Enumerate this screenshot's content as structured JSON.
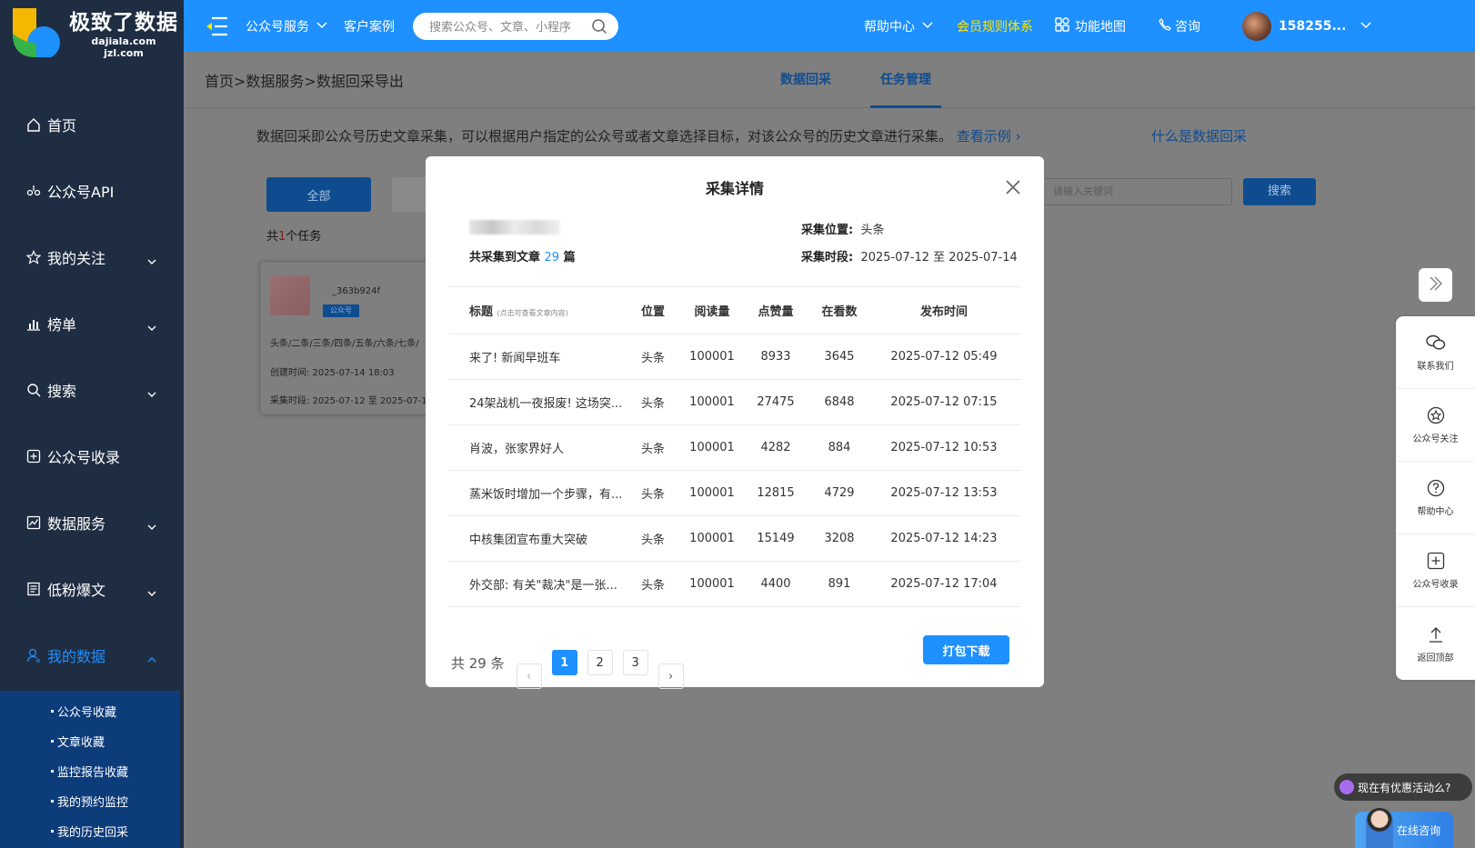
{
  "brand": {
    "name": "极致了数据",
    "domain1": "dajiala.com",
    "domain2": "jzl.com"
  },
  "sidebar": {
    "items": [
      {
        "label": "首页",
        "icon": "home-icon"
      },
      {
        "label": "公众号API",
        "icon": "api-icon"
      },
      {
        "label": "我的关注",
        "icon": "star-icon"
      },
      {
        "label": "榜单",
        "icon": "bar-chart-icon"
      },
      {
        "label": "搜索",
        "icon": "search-icon"
      },
      {
        "label": "公众号收录",
        "icon": "plus-square-icon"
      },
      {
        "label": "数据服务",
        "icon": "line-chart-icon"
      },
      {
        "label": "低粉爆文",
        "icon": "document-icon"
      },
      {
        "label": "我的数据",
        "icon": "user-icon"
      }
    ],
    "subitems": [
      "公众号收藏",
      "文章收藏",
      "监控报告收藏",
      "我的预约监控",
      "我的历史回采"
    ]
  },
  "topbar": {
    "service": "公众号服务",
    "cases": "客户案例",
    "search_placeholder": "搜索公众号、文章、小程序",
    "help": "帮助中心",
    "member": "会员规则体系",
    "function_map": "功能地图",
    "consult": "咨询",
    "user": "158255..."
  },
  "page": {
    "breadcrumb": "首页>数据服务>数据回采导出",
    "tabs": [
      "数据回采",
      "任务管理"
    ],
    "intro": "数据回采即公众号历史文章采集，可以根据用户指定的公众号或者文章选择目标，对该公众号的历史文章进行采集。",
    "intro_link": "查看示例",
    "whatis": "什么是数据回采",
    "btn_all": "全部",
    "count_prefix": "共",
    "count_num": "1",
    "count_suffix": "个任务",
    "keyword_placeholder": "请输入关键词",
    "search_btn": "搜索"
  },
  "task_card": {
    "id": "_363b924f",
    "tag": "公众号",
    "positions": "头条/二条/三条/四条/五条/六条/七条/",
    "created": "创建时间:  2025-07-14 18:03",
    "period": "采集时段:  2025-07-12 至 2025-07-1"
  },
  "modal": {
    "title": "采集详情",
    "total_prefix": "共采集到文章 ",
    "total_num": "29",
    "total_suffix": " 篇",
    "position_label": "采集位置:",
    "position_value": "头条",
    "period_label": "采集时段:",
    "period_value": "2025-07-12 至 2025-07-14",
    "columns": {
      "title": "标题",
      "title_hint": "(点击可查看文章内容)",
      "position": "位置",
      "reads": "阅读量",
      "likes": "点赞量",
      "watching": "在看数",
      "published": "发布时间"
    },
    "rows": [
      {
        "title": "来了! 新闻早班车",
        "position": "头条",
        "reads": "100001",
        "likes": "8933",
        "watching": "3645",
        "published": "2025-07-12 05:49"
      },
      {
        "title": "24架战机一夜报废! 这场突...",
        "position": "头条",
        "reads": "100001",
        "likes": "27475",
        "watching": "6848",
        "published": "2025-07-12 07:15"
      },
      {
        "title": "肖波，张家界好人",
        "position": "头条",
        "reads": "100001",
        "likes": "4282",
        "watching": "884",
        "published": "2025-07-12 10:53"
      },
      {
        "title": "蒸米饭时增加一个步骤，有...",
        "position": "头条",
        "reads": "100001",
        "likes": "12815",
        "watching": "4729",
        "published": "2025-07-12 13:53"
      },
      {
        "title": "中核集团宣布重大突破",
        "position": "头条",
        "reads": "100001",
        "likes": "15149",
        "watching": "3208",
        "published": "2025-07-12 14:23"
      },
      {
        "title": "外交部: 有关\"裁决\"是一张...",
        "position": "头条",
        "reads": "100001",
        "likes": "4400",
        "watching": "891",
        "published": "2025-07-12 17:04"
      }
    ],
    "pager": {
      "total": "共 29 条",
      "pages": [
        "1",
        "2",
        "3"
      ],
      "prev": "‹",
      "next": "›"
    },
    "download": "打包下载"
  },
  "float_panel": {
    "items": [
      {
        "label": "联系我们",
        "icon": "wechat-icon"
      },
      {
        "label": "公众号关注",
        "icon": "star-circle-icon"
      },
      {
        "label": "帮助中心",
        "icon": "question-icon"
      },
      {
        "label": "公众号收录",
        "icon": "plus-box-icon"
      },
      {
        "label": "返回顶部",
        "icon": "upload-icon"
      }
    ]
  },
  "promo": "现在有优惠活动么?",
  "online_consult": "在线咨询",
  "colors": {
    "primary": "#1e90ff",
    "sidebar": "#1f2d42",
    "member": "#ffe600"
  }
}
